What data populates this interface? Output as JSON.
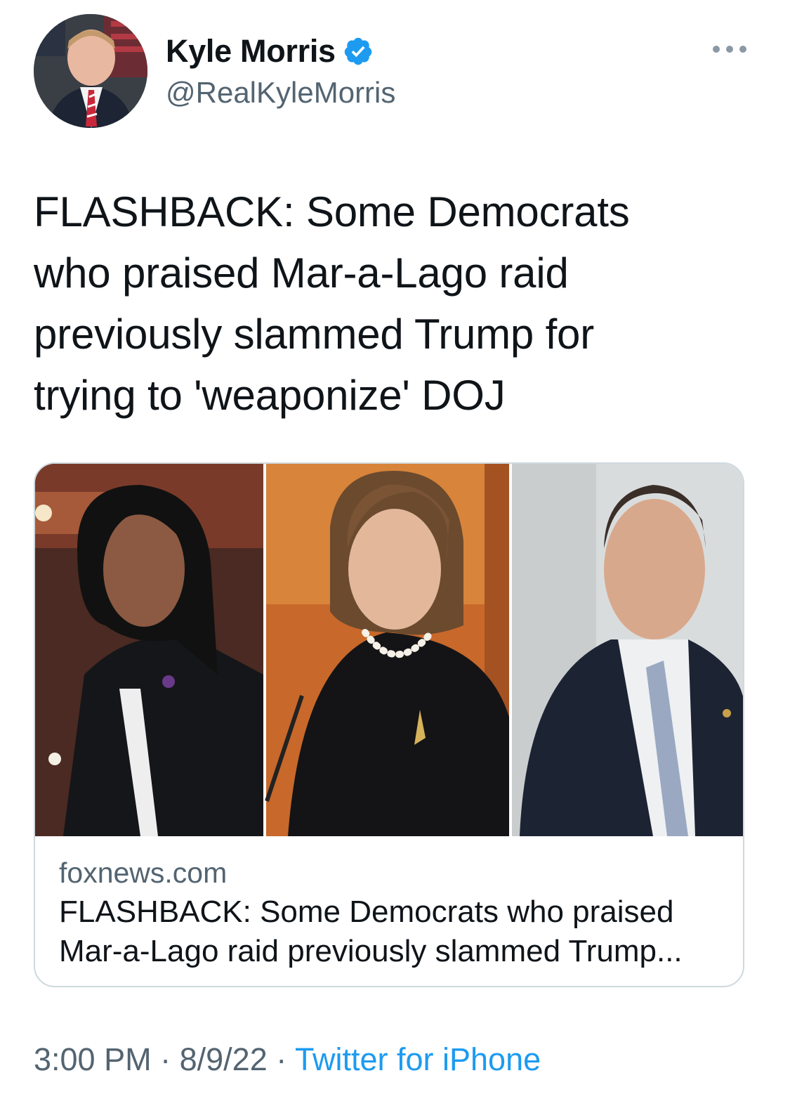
{
  "user": {
    "display_name": "Kyle Morris",
    "handle": "@RealKyleMorris",
    "verified": true
  },
  "more_icon": "more-horizontal-icon",
  "tweet": {
    "text": "FLASHBACK: Some Democrats\nwho praised Mar-a-Lago raid\npreviously slammed Trump for\ntrying to 'weaponize' DOJ"
  },
  "link_card": {
    "domain": "foxnews.com",
    "title": "FLASHBACK: Some Democrats who praised Mar-a-Lago raid previously slammed Trump..."
  },
  "footer": {
    "time": "3:00 PM",
    "separator": "·",
    "date": "8/9/22",
    "source": "Twitter for iPhone"
  },
  "colors": {
    "accent": "#1d9bf0",
    "secondary_text": "#536471",
    "border": "#cfd9de"
  }
}
